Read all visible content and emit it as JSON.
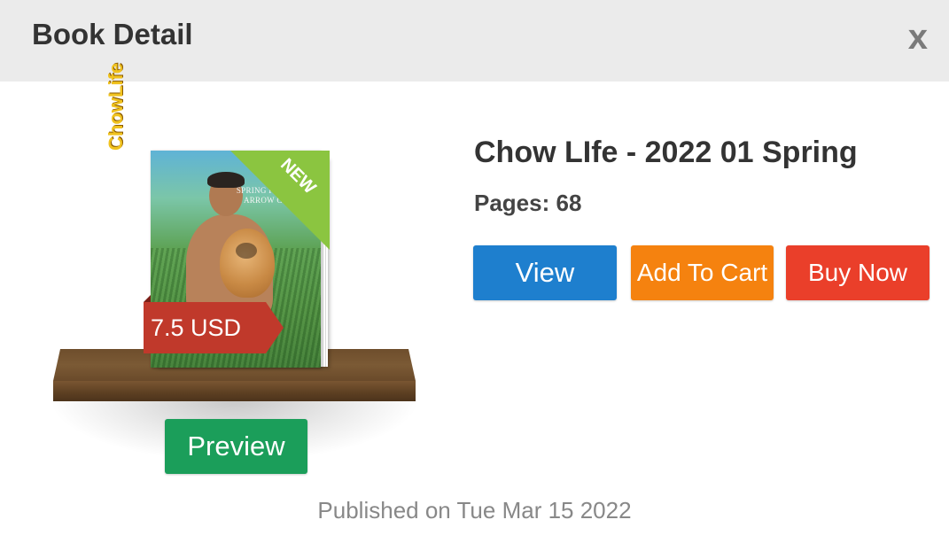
{
  "header": {
    "title": "Book Detail",
    "close_label": "x"
  },
  "book": {
    "title": "Chow LIfe - 2022 01 Spring",
    "pages_label": "Pages: 68",
    "price_label": "7.5 USD",
    "badge": "NEW",
    "cover_text": "SPRING FUN WITH ARROW CHOW",
    "cover_logo": "ChowLife"
  },
  "actions": {
    "preview_label": "Preview",
    "view_label": "View",
    "add_to_cart_label": "Add To Cart",
    "buy_now_label": "Buy Now"
  },
  "footer": {
    "published": "Published on Tue Mar 15 2022"
  },
  "colors": {
    "preview": "#1b9e5a",
    "view": "#1e7fce",
    "add_to_cart": "#f5820f",
    "buy_now": "#ea3f2a",
    "price_tag": "#c0392b",
    "new_badge": "#8bc540"
  }
}
